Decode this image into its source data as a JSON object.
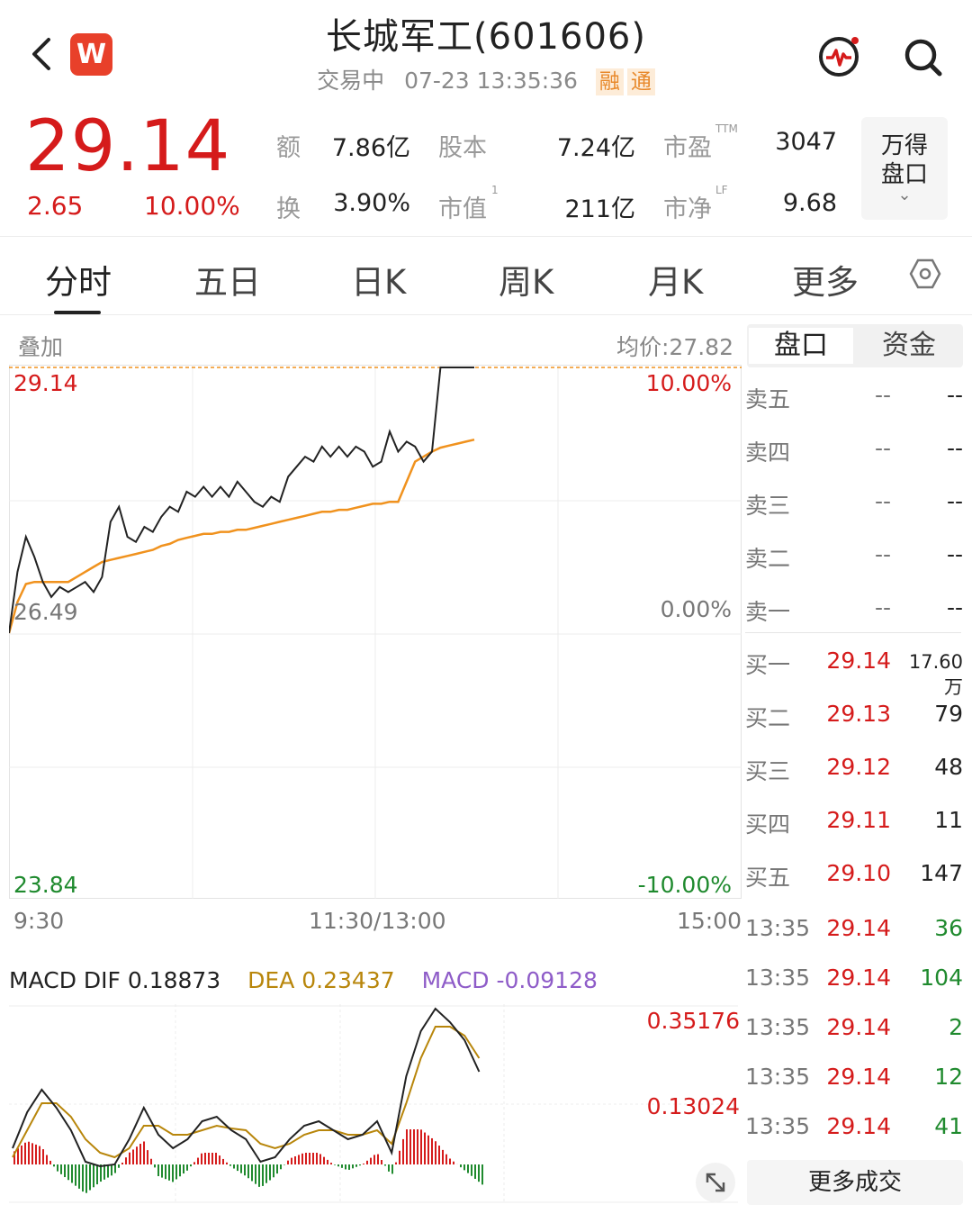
{
  "header": {
    "title": "长城军工(601606)",
    "status": "交易中",
    "datetime": "07-23 13:35:36",
    "tags": [
      "融",
      "通"
    ],
    "logo_text": "W"
  },
  "quote": {
    "price": "29.14",
    "change": "2.65",
    "change_pct": "10.00%",
    "fields": [
      {
        "label": "额",
        "value": "7.86亿"
      },
      {
        "label": "股本",
        "value": "7.24亿"
      },
      {
        "label": "市盈",
        "sup": "TTM",
        "value": "3047"
      },
      {
        "label": "换",
        "value": "3.90%"
      },
      {
        "label": "市值",
        "sup": "1",
        "value": "211亿"
      },
      {
        "label": "市净",
        "sup": "LF",
        "value": "9.68"
      }
    ],
    "wind_button": [
      "万得",
      "盘口"
    ]
  },
  "tabs": [
    "分时",
    "五日",
    "日K",
    "周K",
    "月K",
    "更多"
  ],
  "chart": {
    "overlay_label": "叠加",
    "avg_label": "均价:27.82",
    "price_high": "29.14",
    "price_mid": "26.49",
    "price_low": "23.84",
    "pct_high": "10.00%",
    "pct_mid": "0.00%",
    "pct_low": "-10.00%",
    "time_start": "9:30",
    "time_mid": "11:30/13:00",
    "time_end": "15:00"
  },
  "chart_data": {
    "type": "line",
    "ylim": [
      23.84,
      29.14
    ],
    "series": [
      {
        "values": [
          26.49,
          27.1,
          27.45,
          27.25,
          27.0,
          26.85,
          26.95,
          26.9,
          26.95,
          27.0,
          26.9,
          27.05,
          27.6,
          27.75,
          27.45,
          27.4,
          27.55,
          27.5,
          27.65,
          27.75,
          27.7,
          27.9,
          27.85,
          27.95,
          27.85,
          27.95,
          27.85,
          28.0,
          27.9,
          27.8,
          27.75,
          27.85,
          27.8,
          28.05,
          28.15,
          28.25,
          28.2,
          28.35,
          28.25,
          28.35,
          28.25,
          28.35,
          28.3,
          28.15,
          28.2,
          28.5,
          28.3,
          28.4,
          28.35,
          28.2,
          28.3,
          29.14,
          29.14,
          29.14,
          29.14,
          29.14
        ]
      },
      {
        "values": [
          26.49,
          26.8,
          26.98,
          27.0,
          27.0,
          27.0,
          27.0,
          27.0,
          27.05,
          27.1,
          27.15,
          27.2,
          27.22,
          27.24,
          27.26,
          27.28,
          27.3,
          27.32,
          27.36,
          27.38,
          27.42,
          27.44,
          27.46,
          27.48,
          27.48,
          27.5,
          27.5,
          27.52,
          27.52,
          27.54,
          27.56,
          27.58,
          27.6,
          27.62,
          27.64,
          27.66,
          27.68,
          27.7,
          27.7,
          27.72,
          27.72,
          27.74,
          27.76,
          27.78,
          27.78,
          27.8,
          27.8,
          28.0,
          28.2,
          28.25,
          28.3,
          28.34,
          28.36,
          28.38,
          28.4,
          28.42
        ]
      }
    ]
  },
  "side_tabs": [
    "盘口",
    "资金"
  ],
  "order_book": {
    "asks": [
      {
        "label": "卖五",
        "price": "--",
        "volume": "--"
      },
      {
        "label": "卖四",
        "price": "--",
        "volume": "--"
      },
      {
        "label": "卖三",
        "price": "--",
        "volume": "--"
      },
      {
        "label": "卖二",
        "price": "--",
        "volume": "--"
      },
      {
        "label": "卖一",
        "price": "--",
        "volume": "--"
      }
    ],
    "bids": [
      {
        "label": "买一",
        "price": "29.14",
        "volume": "17.60万"
      },
      {
        "label": "买二",
        "price": "29.13",
        "volume": "79"
      },
      {
        "label": "买三",
        "price": "29.12",
        "volume": "48"
      },
      {
        "label": "买四",
        "price": "29.11",
        "volume": "11"
      },
      {
        "label": "买五",
        "price": "29.10",
        "volume": "147"
      }
    ]
  },
  "trades": [
    {
      "time": "13:35",
      "price": "29.14",
      "volume": "36"
    },
    {
      "time": "13:35",
      "price": "29.14",
      "volume": "104"
    },
    {
      "time": "13:35",
      "price": "29.14",
      "volume": "2"
    },
    {
      "time": "13:35",
      "price": "29.14",
      "volume": "12"
    },
    {
      "time": "13:35",
      "price": "29.14",
      "volume": "41"
    }
  ],
  "more_trades_label": "更多成交",
  "macd": {
    "dif_label": "MACD DIF 0.18873",
    "dea_label": "DEA 0.23437",
    "macd_label": "MACD -0.09128",
    "axis_high": "0.35176",
    "axis_mid": "0.13024"
  },
  "colors": {
    "up": "#d51b1b",
    "down": "#1f8a2e",
    "avg_line": "#f0921e",
    "price_line": "#222222",
    "dea": "#b8860b",
    "macd_label": "#8e5cc8"
  }
}
